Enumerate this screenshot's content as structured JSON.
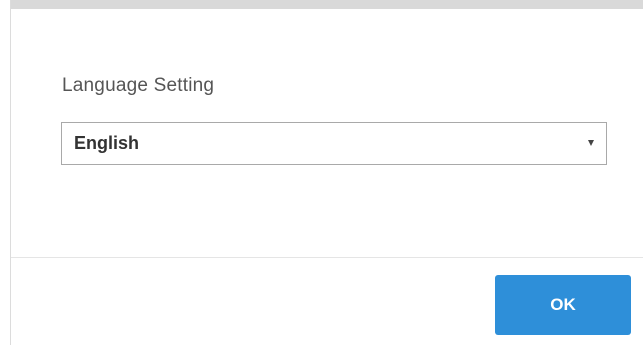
{
  "dialog": {
    "setting_label": "Language Setting",
    "language_select": {
      "selected_value": "English"
    },
    "ok_label": "OK"
  },
  "colors": {
    "ok_button_bg": "#2e8fd9",
    "top_bar": "#d9d9d9"
  }
}
